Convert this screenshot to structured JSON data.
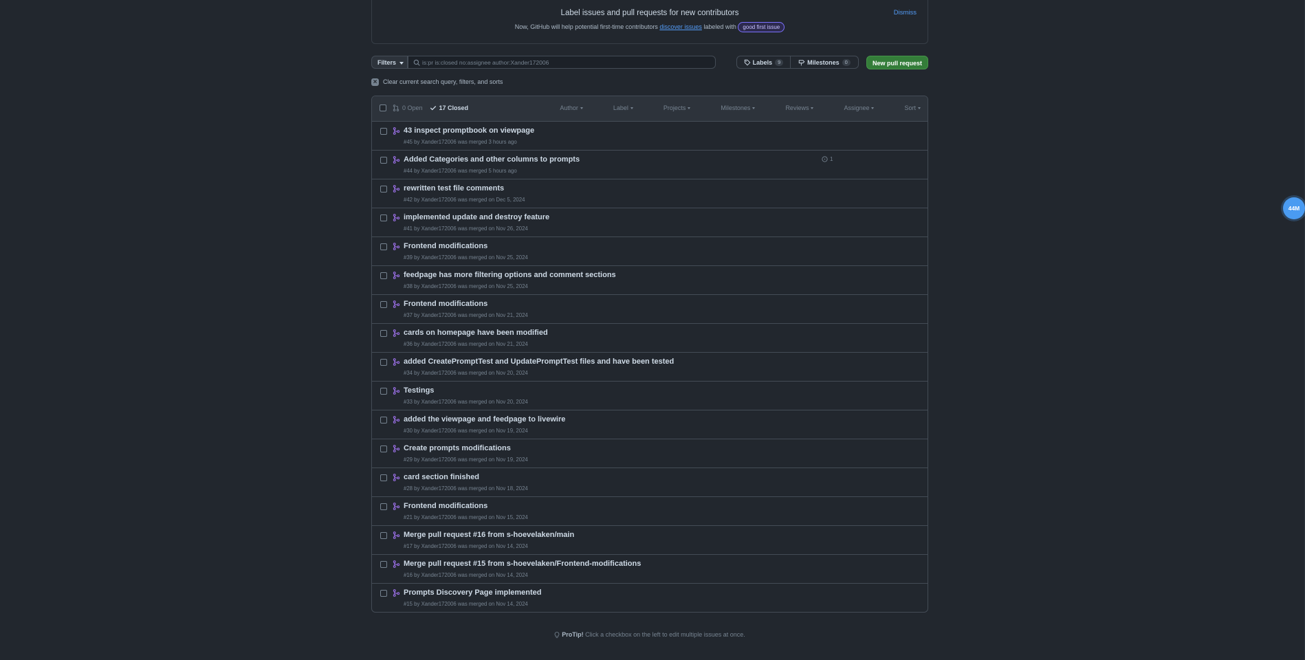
{
  "banner": {
    "title": "Label issues and pull requests for new contributors",
    "sub_prefix": "Now, GitHub will help potential first-time contributors ",
    "sub_link": "discover issues",
    "sub_mid": " labeled with ",
    "badge": "good first issue",
    "dismiss": "Dismiss"
  },
  "toolbar": {
    "filters_label": "Filters",
    "search_value": "is:pr is:closed no:assignee author:Xander172006",
    "labels_label": "Labels",
    "labels_count": "9",
    "milestones_label": "Milestones",
    "milestones_count": "0",
    "new_pr_label": "New pull request"
  },
  "clear_label": "Clear current search query, filters, and sorts",
  "list_header": {
    "open": "0 Open",
    "closed": "17 Closed",
    "filters": [
      "Author",
      "Label",
      "Projects",
      "Milestones",
      "Reviews",
      "Assignee",
      "Sort"
    ]
  },
  "pull_requests": [
    {
      "title": "43 inspect promptbook on viewpage",
      "meta": "#45 by Xander172006 was merged 3 hours ago",
      "comments": ""
    },
    {
      "title": "Added Categories and other columns to prompts",
      "meta": "#44 by Xander172006 was merged 5 hours ago",
      "comments": "1"
    },
    {
      "title": "rewritten test file comments",
      "meta": "#42 by Xander172006 was merged on Dec 5, 2024",
      "comments": ""
    },
    {
      "title": "implemented update and destroy feature",
      "meta": "#41 by Xander172006 was merged on Nov 26, 2024",
      "comments": ""
    },
    {
      "title": "Frontend modifications",
      "meta": "#39 by Xander172006 was merged on Nov 25, 2024",
      "comments": ""
    },
    {
      "title": "feedpage has more filtering options and comment sections",
      "meta": "#38 by Xander172006 was merged on Nov 25, 2024",
      "comments": ""
    },
    {
      "title": "Frontend modifications",
      "meta": "#37 by Xander172006 was merged on Nov 21, 2024",
      "comments": ""
    },
    {
      "title": "cards on homepage have been modified",
      "meta": "#36 by Xander172006 was merged on Nov 21, 2024",
      "comments": ""
    },
    {
      "title": "added CreatePromptTest and UpdatePromptTest files and have been tested",
      "meta": "#34 by Xander172006 was merged on Nov 20, 2024",
      "comments": ""
    },
    {
      "title": "Testings",
      "meta": "#33 by Xander172006 was merged on Nov 20, 2024",
      "comments": ""
    },
    {
      "title": "added the viewpage and feedpage to livewire",
      "meta": "#30 by Xander172006 was merged on Nov 19, 2024",
      "comments": ""
    },
    {
      "title": "Create prompts modifications",
      "meta": "#29 by Xander172006 was merged on Nov 19, 2024",
      "comments": ""
    },
    {
      "title": "card section finished",
      "meta": "#28 by Xander172006 was merged on Nov 18, 2024",
      "comments": ""
    },
    {
      "title": "Frontend modifications",
      "meta": "#21 by Xander172006 was merged on Nov 15, 2024",
      "comments": ""
    },
    {
      "title": "Merge pull request #16 from s-hoevelaken/main",
      "meta": "#17 by Xander172006 was merged on Nov 14, 2024",
      "comments": ""
    },
    {
      "title": "Merge pull request #15 from s-hoevelaken/Frontend-modifications",
      "meta": "#16 by Xander172006 was merged on Nov 14, 2024",
      "comments": ""
    },
    {
      "title": "Prompts Discovery Page implemented",
      "meta": "#15 by Xander172006 was merged on Nov 14, 2024",
      "comments": ""
    }
  ],
  "protip": {
    "bold": "ProTip!",
    "text": " Click a checkbox on the left to edit multiple issues at once."
  },
  "bubble": "44M",
  "colors": {
    "background": "#22272e",
    "accent_green": "#347d39",
    "merged_purple": "#986ee2",
    "link_blue": "#539bf5"
  }
}
